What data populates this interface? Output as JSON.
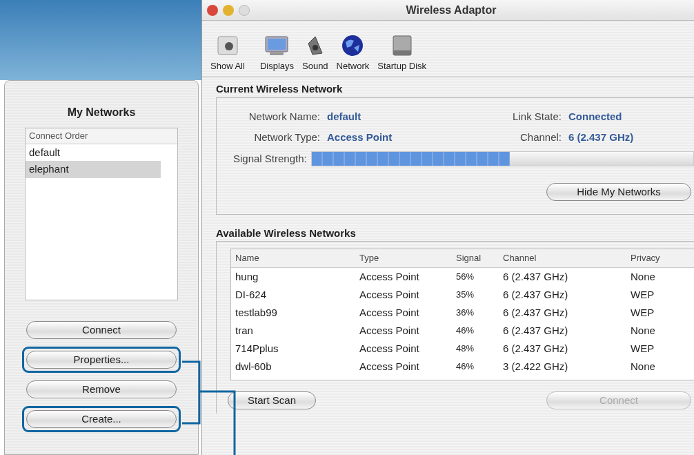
{
  "window": {
    "title": "Wireless Adaptor"
  },
  "toolbar": [
    {
      "label": "Show All",
      "kind": "showall"
    },
    {
      "label": "Displays",
      "kind": "display"
    },
    {
      "label": "Sound",
      "kind": "sound"
    },
    {
      "label": "Network",
      "kind": "network"
    },
    {
      "label": "Startup Disk",
      "kind": "disk"
    }
  ],
  "drawer": {
    "title": "My Networks",
    "list_header": "Connect Order",
    "items": [
      {
        "name": "default",
        "selected": false
      },
      {
        "name": "elephant",
        "selected": true
      }
    ],
    "buttons": [
      {
        "label": "Connect",
        "highlighted": false
      },
      {
        "label": "Properties...",
        "highlighted": true
      },
      {
        "label": "Remove",
        "highlighted": false
      },
      {
        "label": "Create...",
        "highlighted": true
      }
    ]
  },
  "current": {
    "title": "Current Wireless Network",
    "network_name_label": "Network Name:",
    "network_name": "default",
    "link_state_label": "Link State:",
    "link_state": "Connected",
    "network_type_label": "Network Type:",
    "network_type": "Access Point",
    "channel_label": "Channel:",
    "channel": "6 (2.437 GHz)",
    "signal_label": "Signal Strength:",
    "signal": {
      "level": 0.52
    },
    "button": "Hide My Networks"
  },
  "available": {
    "title": "Available Wireless Networks",
    "columns": [
      "Name",
      "Type",
      "Signal",
      "Channel",
      "Privacy"
    ],
    "rows": [
      [
        "hung",
        "Access Point",
        "56%",
        "6 (2.437 GHz)",
        "None"
      ],
      [
        "DI-624",
        "Access Point",
        "35%",
        "6 (2.437 GHz)",
        "WEP"
      ],
      [
        "testlab99",
        "Access Point",
        "36%",
        "6 (2.437 GHz)",
        "WEP"
      ],
      [
        "tran",
        "Access Point",
        "46%",
        "6 (2.437 GHz)",
        "None"
      ],
      [
        "714Pplus",
        "Access Point",
        "48%",
        "6 (2.437 GHz)",
        "WEP"
      ],
      [
        "dwl-60b",
        "Access Point",
        "46%",
        "3 (2.422 GHz)",
        "None"
      ]
    ],
    "buttons": [
      {
        "label": "Start Scan",
        "disabled": false
      },
      {
        "label": "Connect",
        "disabled": true
      }
    ]
  }
}
